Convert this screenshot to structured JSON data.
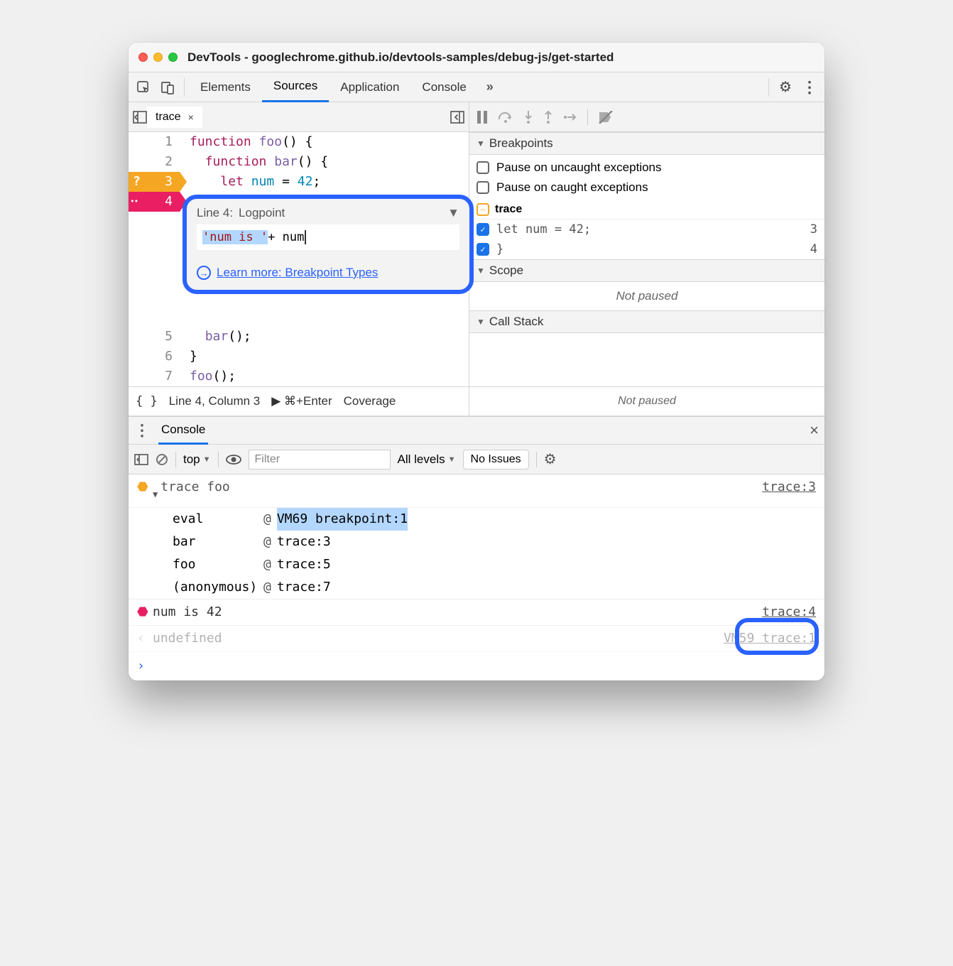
{
  "window": {
    "title": "DevTools - googlechrome.github.io/devtools-samples/debug-js/get-started"
  },
  "tabs": {
    "items": [
      "Elements",
      "Sources",
      "Application",
      "Console"
    ],
    "active_index": 1,
    "more": "»"
  },
  "file_tab": {
    "name": "trace",
    "close": "×"
  },
  "code": {
    "lines": [
      {
        "n": 1,
        "text": "function foo() {"
      },
      {
        "n": 2,
        "text": "  function bar() {"
      },
      {
        "n": 3,
        "text": "    let num = 42;",
        "bp": "orange"
      },
      {
        "n": 4,
        "text": "  }",
        "bp": "pink"
      },
      {
        "n": 5,
        "text": "  bar();"
      },
      {
        "n": 6,
        "text": "}"
      },
      {
        "n": 7,
        "text": "foo();"
      }
    ]
  },
  "popup": {
    "line_label": "Line 4:",
    "type": "Logpoint",
    "input_prefix": "'num is '",
    "input_rest": " + num",
    "learn_more": "Learn more: Breakpoint Types"
  },
  "status": {
    "brackets": "{ }",
    "pos": "Line 4, Column 3",
    "run": "▶ ⌘+Enter",
    "coverage": "Coverage",
    "not_paused": "Not paused"
  },
  "breakpoints": {
    "title": "Breakpoints",
    "opt1": "Pause on uncaught exceptions",
    "opt2": "Pause on caught exceptions",
    "group": "trace",
    "items": [
      {
        "text": "let num = 42;",
        "line": "3",
        "checked": true
      },
      {
        "text": "}",
        "line": "4",
        "checked": true
      }
    ]
  },
  "scope": {
    "title": "Scope",
    "body": "Not paused"
  },
  "callstack": {
    "title": "Call Stack",
    "body": "Not paused"
  },
  "drawer": {
    "tabs": {
      "console": "Console",
      "close": "×"
    },
    "toolbar": {
      "context": "top",
      "filter_placeholder": "Filter",
      "levels": "All levels",
      "issues": "No Issues"
    }
  },
  "console": {
    "msg1": {
      "head": "trace foo",
      "source": "trace:3",
      "stack": [
        {
          "name": "eval",
          "at": "@",
          "link": "VM69 breakpoint:1",
          "hl": true
        },
        {
          "name": "bar",
          "at": "@",
          "link": "trace:3"
        },
        {
          "name": "foo",
          "at": "@",
          "link": "trace:5"
        },
        {
          "name": "(anonymous)",
          "at": "@",
          "link": "trace:7"
        }
      ]
    },
    "msg2": {
      "text": "num is 42",
      "source": "trace:4"
    },
    "msg3": {
      "text": "undefined",
      "source": "VM59 trace:1"
    }
  }
}
